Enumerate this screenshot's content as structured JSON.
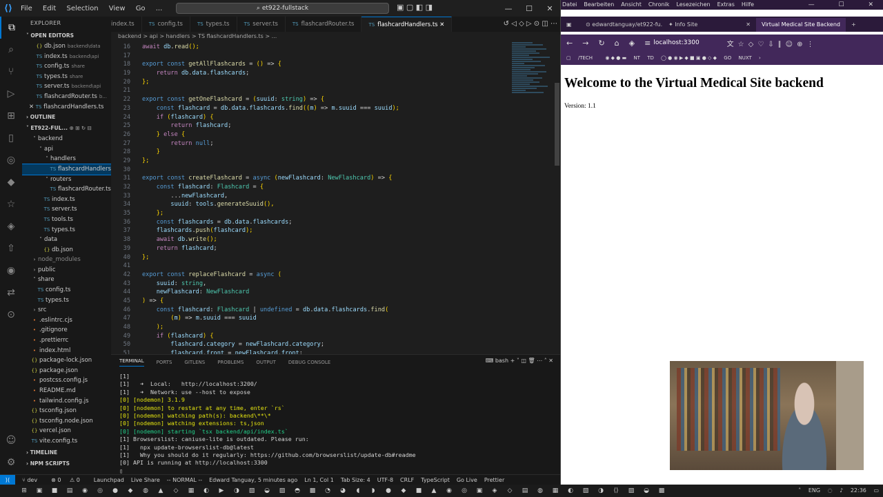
{
  "vscode": {
    "menu": [
      "File",
      "Edit",
      "Selection",
      "View",
      "Go",
      "..."
    ],
    "search": "et922-fullstack",
    "tabs": [
      {
        "label": "index.ts",
        "prefix": ""
      },
      {
        "label": "config.ts",
        "prefix": "TS"
      },
      {
        "label": "types.ts",
        "prefix": "TS"
      },
      {
        "label": "server.ts",
        "prefix": "TS"
      },
      {
        "label": "flashcardRouter.ts",
        "prefix": "TS"
      },
      {
        "label": "flashcardHandlers.ts",
        "prefix": "TS"
      }
    ],
    "breadcrumb": "backend > api > handlers > TS flashcardHandlers.ts > ...",
    "explorer": {
      "title": "EXPLORER",
      "open_editors_title": "OPEN EDITORS",
      "open_editors": [
        {
          "name": "db.json",
          "desc": "backend\\data",
          "ic": "{}"
        },
        {
          "name": "index.ts",
          "desc": "backend\\api",
          "ic": "TS"
        },
        {
          "name": "config.ts",
          "desc": "share",
          "ic": "TS"
        },
        {
          "name": "types.ts",
          "desc": "share",
          "ic": "TS"
        },
        {
          "name": "server.ts",
          "desc": "backend\\api",
          "ic": "TS"
        },
        {
          "name": "flashcardRouter.ts",
          "desc": "b...",
          "ic": "TS"
        },
        {
          "name": "flashcardHandlers.ts",
          "desc": "",
          "ic": "TS"
        }
      ],
      "outline_title": "OUTLINE",
      "project_title": "ET922-FUL...",
      "tree": [
        {
          "name": "backend",
          "depth": 1,
          "type": "folder-open"
        },
        {
          "name": "api",
          "depth": 2,
          "type": "folder-open"
        },
        {
          "name": "handlers",
          "depth": 3,
          "type": "folder-open"
        },
        {
          "name": "flashcardHandlers.ts",
          "depth": 4,
          "type": "ts",
          "selected": true
        },
        {
          "name": "routers",
          "depth": 3,
          "type": "folder-open"
        },
        {
          "name": "flashcardRouter.ts",
          "depth": 4,
          "type": "ts"
        },
        {
          "name": "index.ts",
          "depth": 3,
          "type": "ts"
        },
        {
          "name": "server.ts",
          "depth": 3,
          "type": "ts"
        },
        {
          "name": "tools.ts",
          "depth": 3,
          "type": "ts"
        },
        {
          "name": "types.ts",
          "depth": 3,
          "type": "ts"
        },
        {
          "name": "data",
          "depth": 2,
          "type": "folder-open"
        },
        {
          "name": "db.json",
          "depth": 3,
          "type": "json"
        },
        {
          "name": "node_modules",
          "depth": 1,
          "type": "folder",
          "dim": true
        },
        {
          "name": "public",
          "depth": 1,
          "type": "folder"
        },
        {
          "name": "share",
          "depth": 1,
          "type": "folder-open"
        },
        {
          "name": "config.ts",
          "depth": 2,
          "type": "ts"
        },
        {
          "name": "types.ts",
          "depth": 2,
          "type": "ts"
        },
        {
          "name": "src",
          "depth": 1,
          "type": "folder"
        },
        {
          "name": ".eslintrc.cjs",
          "depth": 1,
          "type": "file"
        },
        {
          "name": ".gitignore",
          "depth": 1,
          "type": "file"
        },
        {
          "name": ".prettierrc",
          "depth": 1,
          "type": "file"
        },
        {
          "name": "index.html",
          "depth": 1,
          "type": "file"
        },
        {
          "name": "package-lock.json",
          "depth": 1,
          "type": "json"
        },
        {
          "name": "package.json",
          "depth": 1,
          "type": "json"
        },
        {
          "name": "postcss.config.js",
          "depth": 1,
          "type": "file"
        },
        {
          "name": "README.md",
          "depth": 1,
          "type": "file"
        },
        {
          "name": "tailwind.config.js",
          "depth": 1,
          "type": "file"
        },
        {
          "name": "tsconfig.json",
          "depth": 1,
          "type": "json"
        },
        {
          "name": "tsconfig.node.json",
          "depth": 1,
          "type": "json"
        },
        {
          "name": "vercel.json",
          "depth": 1,
          "type": "json"
        },
        {
          "name": "vite.config.ts",
          "depth": 1,
          "type": "ts"
        }
      ],
      "timeline_title": "TIMELINE",
      "npm_title": "NPM SCRIPTS"
    },
    "code_lines": [
      {
        "n": "16",
        "t": "await db.read();"
      },
      {
        "n": "17",
        "t": ""
      },
      {
        "n": "18",
        "t": "export const getAllFlashcards = () => {"
      },
      {
        "n": "19",
        "t": "    return db.data.flashcards;"
      },
      {
        "n": "20",
        "t": "};"
      },
      {
        "n": "21",
        "t": ""
      },
      {
        "n": "22",
        "t": "export const getOneFlashcard = (suuid: string) => {"
      },
      {
        "n": "23",
        "t": "    const flashcard = db.data.flashcards.find((m) => m.suuid === suuid);"
      },
      {
        "n": "24",
        "t": "    if (flashcard) {"
      },
      {
        "n": "25",
        "t": "        return flashcard;"
      },
      {
        "n": "26",
        "t": "    } else {"
      },
      {
        "n": "27",
        "t": "        return null;"
      },
      {
        "n": "28",
        "t": "    }"
      },
      {
        "n": "29",
        "t": "};"
      },
      {
        "n": "30",
        "t": ""
      },
      {
        "n": "31",
        "t": "export const createFlashcard = async (newFlashcard: NewFlashcard) => {"
      },
      {
        "n": "32",
        "t": "    const flashcard: Flashcard = {"
      },
      {
        "n": "33",
        "t": "        ...newFlashcard,"
      },
      {
        "n": "34",
        "t": "        suuid: tools.generateSuuid(),"
      },
      {
        "n": "35",
        "t": "    };"
      },
      {
        "n": "36",
        "t": "    const flashcards = db.data.flashcards;"
      },
      {
        "n": "37",
        "t": "    flashcards.push(flashcard);"
      },
      {
        "n": "38",
        "t": "    await db.write();"
      },
      {
        "n": "39",
        "t": "    return flashcard;"
      },
      {
        "n": "40",
        "t": "};"
      },
      {
        "n": "41",
        "t": ""
      },
      {
        "n": "42",
        "t": "export const replaceFlashcard = async ("
      },
      {
        "n": "43",
        "t": "    suuid: string,"
      },
      {
        "n": "44",
        "t": "    newFlashcard: NewFlashcard"
      },
      {
        "n": "45",
        "t": ") => {"
      },
      {
        "n": "46",
        "t": "    const flashcard: Flashcard | undefined = db.data.flashcards.find("
      },
      {
        "n": "47",
        "t": "        (m) => m.suuid === suuid"
      },
      {
        "n": "48",
        "t": "    );"
      },
      {
        "n": "49",
        "t": "    if (flashcard) {"
      },
      {
        "n": "50",
        "t": "        flashcard.category = newFlashcard.category;"
      },
      {
        "n": "51",
        "t": "        flashcard.front = newFlashcard.front;"
      }
    ],
    "panel_tabs": [
      "TERMINAL",
      "PORTS",
      "GITLENS",
      "PROBLEMS",
      "OUTPUT",
      "DEBUG CONSOLE"
    ],
    "panel_shell": "bash",
    "terminal_lines": [
      "[1]",
      "[1]   ➜  Local:   http://localhost:3200/",
      "[1]   ➜  Network: use --host to expose",
      "[0] [nodemon] 3.1.9",
      "[0] [nodemon] to restart at any time, enter `rs`",
      "[0] [nodemon] watching path(s): backend\\**\\*",
      "[0] [nodemon] watching extensions: ts,json",
      "[0] [nodemon] starting `tsx backend/api/index.ts`",
      "[1] Browserslist: caniuse-lite is outdated. Please run:",
      "[1]   npx update-browserslist-db@latest",
      "[1]   Why you should do it regularly: https://github.com/browserslist/update-db#readme",
      "[0] API is running at http://localhost:3300",
      "▯"
    ],
    "status": {
      "branch": "dev",
      "errors": "0",
      "warnings": "0",
      "launchpad": "Launchpad",
      "live_share": "Live Share",
      "mode": "-- NORMAL --",
      "blame": "Edward Tanguay, 5 minutes ago",
      "position": "Ln 1, Col 1",
      "tab_size": "Tab Size: 4",
      "encoding": "UTF-8",
      "eol": "CRLF",
      "language": "TypeScript",
      "go_live": "Go Live",
      "prettier": "Prettier"
    }
  },
  "browser": {
    "menu": [
      "Datei",
      "Bearbeiten",
      "Ansicht",
      "Chronik",
      "Lesezeichen",
      "Extras",
      "Hilfe"
    ],
    "tabs": [
      {
        "label": "edwardtanguay/et922-fu..."
      },
      {
        "label": "Info Site"
      },
      {
        "label": "Virtual Medical Site Backend"
      }
    ],
    "url": "localhost:3300",
    "bookmarks": [
      "TECH",
      "NT",
      "TD",
      "GO",
      "NUXT"
    ],
    "heading": "Welcome to the Virtual Medical Site backend",
    "version": "Version: 1.1"
  },
  "taskbar": {
    "lang": "ENG",
    "time": "22:36"
  }
}
